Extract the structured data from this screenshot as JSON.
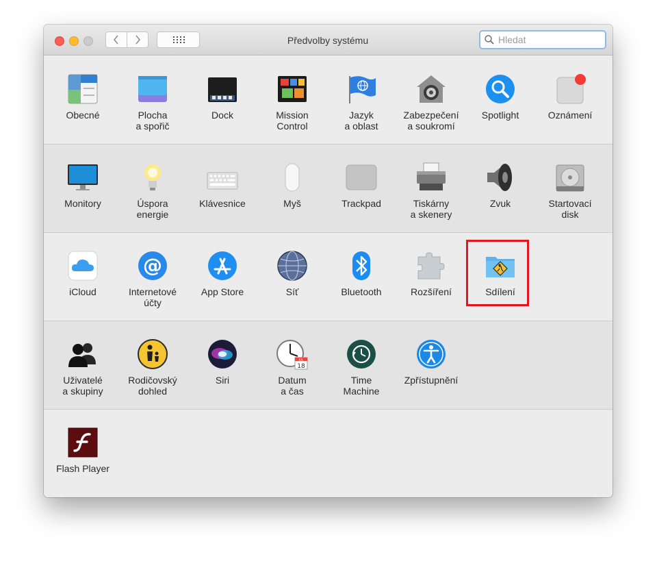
{
  "window": {
    "title": "Předvolby systému",
    "search_placeholder": "Hledat"
  },
  "rows": [
    [
      {
        "id": "obecne",
        "label": "Obecné",
        "icon": "general-icon"
      },
      {
        "id": "plocha",
        "label": "Plocha\na spořič",
        "icon": "desktop-screensaver-icon"
      },
      {
        "id": "dock",
        "label": "Dock",
        "icon": "dock-icon"
      },
      {
        "id": "mission",
        "label": "Mission\nControl",
        "icon": "mission-control-icon"
      },
      {
        "id": "jazyk",
        "label": "Jazyk\na oblast",
        "icon": "language-flag-icon"
      },
      {
        "id": "zabezpeceni",
        "label": "Zabezpečení\na soukromí",
        "icon": "security-house-icon"
      },
      {
        "id": "spotlight",
        "label": "Spotlight",
        "icon": "spotlight-icon"
      },
      {
        "id": "oznameni",
        "label": "Oznámení",
        "icon": "notifications-icon"
      }
    ],
    [
      {
        "id": "monitory",
        "label": "Monitory",
        "icon": "display-icon"
      },
      {
        "id": "uspora",
        "label": "Úspora\nenergie",
        "icon": "lightbulb-icon"
      },
      {
        "id": "klavesnice",
        "label": "Klávesnice",
        "icon": "keyboard-icon"
      },
      {
        "id": "mys",
        "label": "Myš",
        "icon": "mouse-icon"
      },
      {
        "id": "trackpad",
        "label": "Trackpad",
        "icon": "trackpad-icon"
      },
      {
        "id": "tiskarny",
        "label": "Tiskárny\na skenery",
        "icon": "printer-icon"
      },
      {
        "id": "zvuk",
        "label": "Zvuk",
        "icon": "speaker-icon"
      },
      {
        "id": "startovaci",
        "label": "Startovací\ndisk",
        "icon": "hard-disk-icon"
      }
    ],
    [
      {
        "id": "icloud",
        "label": "iCloud",
        "icon": "icloud-icon"
      },
      {
        "id": "internetove",
        "label": "Internetové\núčty",
        "icon": "at-sign-icon"
      },
      {
        "id": "appstore",
        "label": "App Store",
        "icon": "app-store-icon"
      },
      {
        "id": "sit",
        "label": "Síť",
        "icon": "network-globe-icon"
      },
      {
        "id": "bluetooth",
        "label": "Bluetooth",
        "icon": "bluetooth-icon"
      },
      {
        "id": "rozsireni",
        "label": "Rozšíření",
        "icon": "puzzle-icon"
      },
      {
        "id": "sdileni",
        "label": "Sdílení",
        "icon": "sharing-folder-icon"
      }
    ],
    [
      {
        "id": "uzivatele",
        "label": "Uživatelé\na skupiny",
        "icon": "users-icon"
      },
      {
        "id": "rodicovsky",
        "label": "Rodičovský\ndohled",
        "icon": "parental-controls-icon"
      },
      {
        "id": "siri",
        "label": "Siri",
        "icon": "siri-icon"
      },
      {
        "id": "datum",
        "label": "Datum\na čas",
        "icon": "clock-calendar-icon",
        "calendar_month": "JUL",
        "calendar_day": "18"
      },
      {
        "id": "timemachine",
        "label": "Time\nMachine",
        "icon": "time-machine-icon"
      },
      {
        "id": "zpristupneni",
        "label": "Zpřístupnění",
        "icon": "accessibility-icon"
      }
    ],
    [
      {
        "id": "flash",
        "label": "Flash Player",
        "icon": "flash-player-icon"
      }
    ]
  ],
  "highlight_target": "Sdílení"
}
